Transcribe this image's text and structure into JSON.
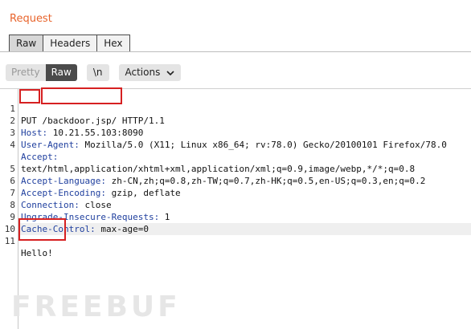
{
  "panel": {
    "title": "Request"
  },
  "tabs": [
    {
      "label": "Raw",
      "active": true
    },
    {
      "label": "Headers",
      "active": false
    },
    {
      "label": "Hex",
      "active": false
    }
  ],
  "toolbar": {
    "view_modes": [
      {
        "label": "Pretty",
        "active": false
      },
      {
        "label": "Raw",
        "active": true
      }
    ],
    "newline_label": "\\n",
    "actions_label": "Actions"
  },
  "editor": {
    "request_line": {
      "method": "PUT",
      "separator": " ",
      "path": "/backdoor.jsp/",
      "version": " HTTP/1.1"
    },
    "lines": [
      {
        "num": "1"
      },
      {
        "num": "2",
        "name": "Host:",
        "value": " 10.21.55.103:8090"
      },
      {
        "num": "3",
        "name": "User-Agent:",
        "value": " Mozilla/5.0 (X11; Linux x86_64; rv:78.0) Gecko/20100101 Firefox/78.0"
      },
      {
        "num": "4",
        "name": "Accept:",
        "value": ""
      },
      {
        "num": "",
        "name": "",
        "value": "text/html,application/xhtml+xml,application/xml;q=0.9,image/webp,*/*;q=0.8"
      },
      {
        "num": "5",
        "name": "Accept-Language:",
        "value": " zh-CN,zh;q=0.8,zh-TW;q=0.7,zh-HK;q=0.5,en-US;q=0.3,en;q=0.2"
      },
      {
        "num": "6",
        "name": "Accept-Encoding:",
        "value": " gzip, deflate"
      },
      {
        "num": "7",
        "name": "Connection:",
        "value": " close"
      },
      {
        "num": "8",
        "name": "Upgrade-Insecure-Requests:",
        "value": " 1"
      },
      {
        "num": "9",
        "name": "Cache-Control:",
        "value": " max-age=0"
      },
      {
        "num": "10",
        "name": "",
        "value": ""
      },
      {
        "num": "11",
        "name": "",
        "value": "Hello!"
      }
    ]
  },
  "watermark": "FREEBUF",
  "colors": {
    "title": "#e8642c",
    "header_name": "#1f3f9e",
    "highlight_box": "#d62021"
  }
}
